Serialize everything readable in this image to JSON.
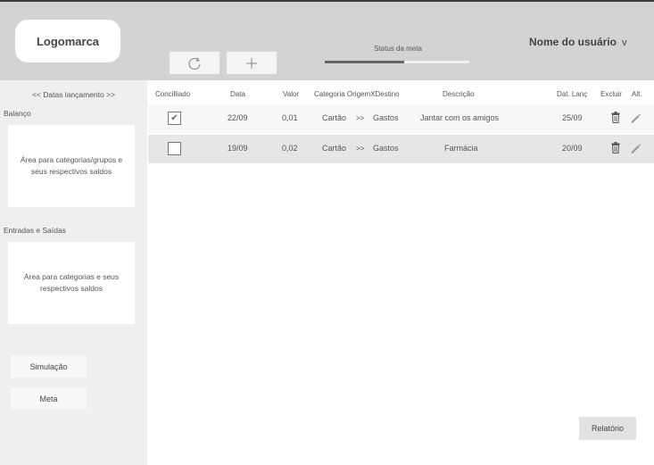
{
  "header": {
    "logo_label": "Logomarca",
    "sync_icon": "refresh-icon",
    "add_icon": "plus-icon",
    "status_label": "Status da meta",
    "status_progress": 0.55,
    "user_name": "Nome do usuário",
    "user_chevron": "v"
  },
  "sidebar": {
    "dates_nav": "<< Datas lançamento >>",
    "balance_title": "Balanço",
    "balance_panel_text": "Área para categorias/grupos e seus respectivos saldos",
    "flows_title": "Entradas e Saídas",
    "flows_panel_text": "Área para categorias e seus respectivos saldos",
    "simulation_label": "Simulação",
    "goal_label": "Meta"
  },
  "table": {
    "columns": {
      "reconciled": "Concilliado",
      "date": "Data",
      "value": "Valor",
      "category": "Categoria OrigemXDestino",
      "description": "Descrição",
      "entry_date": "Dat. Lanç",
      "delete": "Excluir",
      "edit": "Alt."
    },
    "rows": [
      {
        "reconciled": true,
        "check_mark": "✔",
        "date": "22/09",
        "value": "0,01",
        "origin": "Cartão",
        "arrow": ">>",
        "destination": "Gastos",
        "description": "Jantar com os amigos",
        "entry_date": "25/09"
      },
      {
        "reconciled": false,
        "check_mark": "",
        "date": "19/09",
        "value": "0,02",
        "origin": "Cartão",
        "arrow": ">>",
        "destination": "Gastos",
        "description": "Farmácia",
        "entry_date": "20/09"
      }
    ]
  },
  "footer": {
    "report_label": "Relatório"
  },
  "colors": {
    "header_bg": "#d3d3d3",
    "sidebar_bg": "#efefef",
    "row_odd": "#f7f7f7",
    "row_even": "#e6e6e6",
    "progress": "#666666"
  }
}
